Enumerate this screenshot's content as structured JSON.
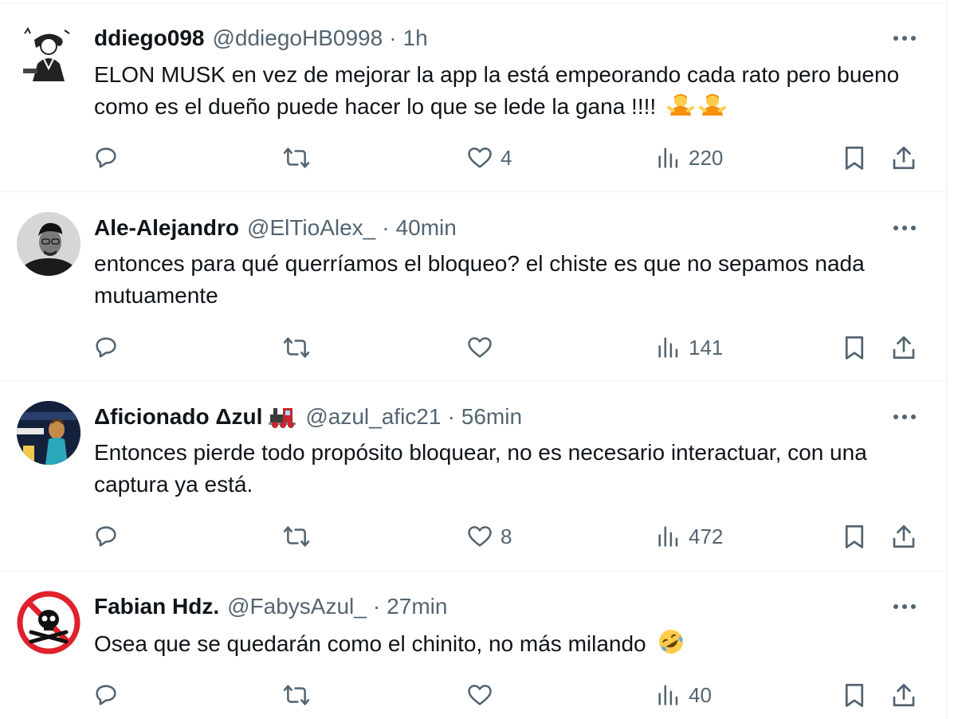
{
  "tweets": [
    {
      "name": "ddiego098",
      "handle": "@ddiegoHB0998",
      "time": "1h",
      "text": "ELON MUSK en vez de mejorar la app la está empeorando cada rato pero bueno como es el dueño puede hacer lo que se lede la gana !!!!",
      "emojis": [
        "person-shrugging",
        "person-shrugging"
      ],
      "replies": "",
      "retweets": "",
      "likes": "4",
      "views": "220"
    },
    {
      "name": "Ale-Alejandro",
      "handle": "@ElTioAlex_",
      "time": "40min",
      "text": "entonces para qué querríamos el bloqueo? el chiste es que no sepamos nada mutuamente",
      "replies": "",
      "retweets": "",
      "likes": "",
      "views": "141"
    },
    {
      "name": "Δficionado Δzul",
      "name_emoji": "locomotive",
      "handle": "@azul_afic21",
      "time": "56min",
      "text": "Entonces pierde todo propósito bloquear, no es necesario interactuar, con una captura ya está.",
      "replies": "",
      "retweets": "",
      "likes": "8",
      "views": "472"
    },
    {
      "name": "Fabian Hdz.",
      "handle": "@FabysAzul_",
      "time": "27min",
      "text": "Osea que se quedarán como el chinito, no más milando",
      "emojis": [
        "rolling-on-floor-laughing"
      ],
      "replies": "",
      "retweets": "",
      "likes": "",
      "views": "40"
    }
  ],
  "separator": "·",
  "colors": {
    "text": "#0f1419",
    "secondary": "#536471",
    "border": "#eff3f4"
  },
  "icons": [
    "more-icon",
    "reply-icon",
    "retweet-icon",
    "like-icon",
    "views-icon",
    "bookmark-icon",
    "share-icon"
  ]
}
